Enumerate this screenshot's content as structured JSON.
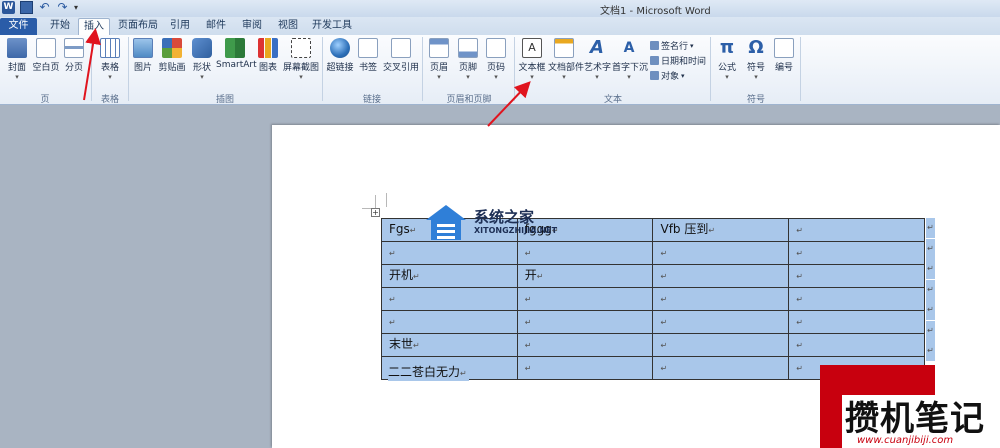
{
  "window": {
    "title": "文档1 - Microsoft Word",
    "quick_access": [
      "word-logo",
      "save-icon",
      "undo-icon",
      "redo-icon",
      "customize-icon"
    ]
  },
  "tabs": [
    {
      "label": "文件"
    },
    {
      "label": "开始"
    },
    {
      "label": "插入",
      "active": true
    },
    {
      "label": "页面布局"
    },
    {
      "label": "引用"
    },
    {
      "label": "邮件"
    },
    {
      "label": "审阅"
    },
    {
      "label": "视图"
    },
    {
      "label": "开发工具"
    }
  ],
  "ribbon": {
    "groups": {
      "pages": "页",
      "tables": "表格",
      "illustrations": "插图",
      "links": "链接",
      "header_footer": "页眉和页脚",
      "text": "文本",
      "symbols": "符号"
    },
    "buttons": {
      "cover": "封面",
      "blank_page": "空白页",
      "page_break": "分页",
      "table": "表格",
      "picture": "图片",
      "clipart": "剪贴画",
      "shapes": "形状",
      "smartart": "SmartArt",
      "chart": "图表",
      "screenshot": "屏幕截图",
      "hyperlink": "超链接",
      "bookmark": "书签",
      "cross_ref": "交叉引用",
      "header": "页眉",
      "footer": "页脚",
      "page_number": "页码",
      "textbox": "文本框",
      "quick_parts": "文档部件",
      "wordart": "艺术字",
      "dropcap": "首字下沉",
      "signature": "签名行",
      "datetime": "日期和时间",
      "object": "对象",
      "equation": "公式",
      "symbol": "符号",
      "number": "编号"
    },
    "icons": {
      "equation": "π",
      "symbol": "Ω"
    }
  },
  "document": {
    "table_handle": "+",
    "table": [
      [
        "Fgs",
        "fggg",
        "Vfb 压到",
        "",
        ""
      ],
      [
        "",
        "",
        "",
        "",
        ""
      ],
      [
        "开机",
        "开",
        "",
        "",
        ""
      ],
      [
        "",
        "",
        "",
        "",
        ""
      ],
      [
        "",
        "",
        "",
        "",
        ""
      ],
      [
        "末世",
        "",
        "",
        "",
        ""
      ],
      [
        "",
        "",
        "",
        "",
        ""
      ]
    ],
    "paragraph": "二二苍白无力",
    "cell_mark": "↵"
  },
  "watermarks": {
    "site1_name": "系统之家",
    "site1_url": "XITONGZHIJIA.NET",
    "site2_name": "攒机笔记",
    "site2_url": "www.cuanjibiji.com"
  },
  "colors": {
    "selection": "#a9c7ea",
    "accent_file_tab": "#2a5ca8",
    "annotation": "#e0141e"
  }
}
